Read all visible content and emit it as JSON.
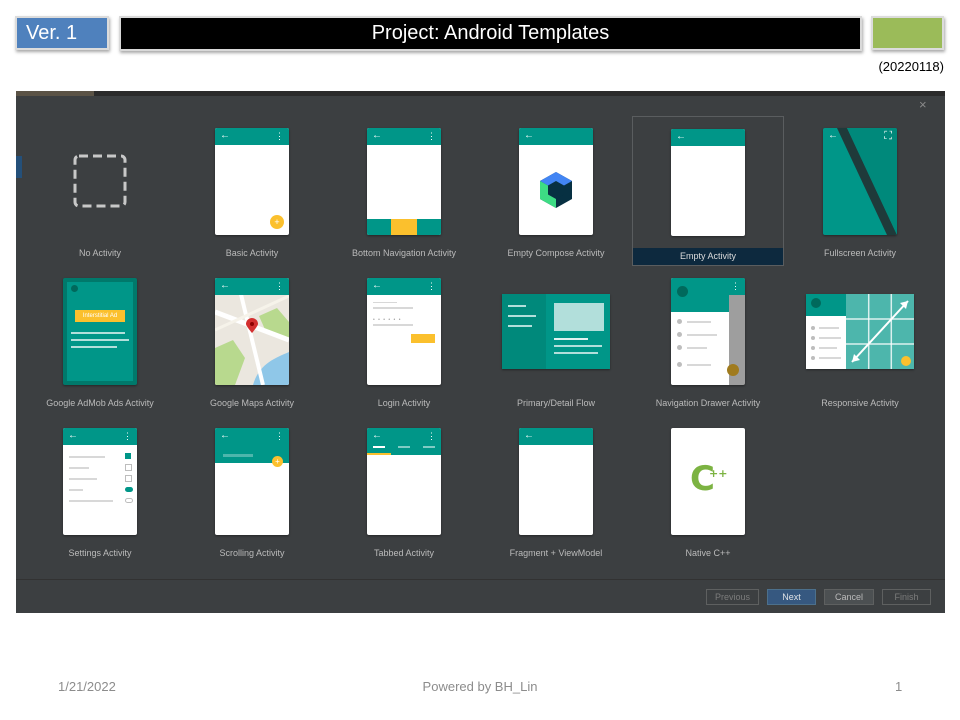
{
  "slide": {
    "version_label": "Ver. 1",
    "title": "Project: Android Templates",
    "date_code": "(20220118)",
    "footer": {
      "date": "1/21/2022",
      "center": "Powered by BH_Lin",
      "page": "1"
    }
  },
  "dialog": {
    "close_glyph": "×",
    "templates": [
      {
        "label": "No Activity",
        "preview": "none",
        "selected": false
      },
      {
        "label": "Basic Activity",
        "preview": "basic",
        "selected": false
      },
      {
        "label": "Bottom Navigation Activity",
        "preview": "bottom-nav",
        "selected": false
      },
      {
        "label": "Empty Compose Activity",
        "preview": "compose",
        "selected": false
      },
      {
        "label": "Empty Activity",
        "preview": "empty",
        "selected": true
      },
      {
        "label": "Fullscreen Activity",
        "preview": "fullscreen",
        "selected": false
      },
      {
        "label": "Google AdMob Ads Activity",
        "preview": "admob",
        "selected": false
      },
      {
        "label": "Google Maps Activity",
        "preview": "maps",
        "selected": false
      },
      {
        "label": "Login Activity",
        "preview": "login",
        "selected": false
      },
      {
        "label": "Primary/Detail Flow",
        "preview": "primary-detail",
        "selected": false
      },
      {
        "label": "Navigation Drawer Activity",
        "preview": "nav-drawer",
        "selected": false
      },
      {
        "label": "Responsive Activity",
        "preview": "responsive",
        "selected": false
      },
      {
        "label": "Settings Activity",
        "preview": "settings",
        "selected": false
      },
      {
        "label": "Scrolling Activity",
        "preview": "scrolling",
        "selected": false
      },
      {
        "label": "Tabbed Activity",
        "preview": "tabbed",
        "selected": false
      },
      {
        "label": "Fragment + ViewModel",
        "preview": "fragment",
        "selected": false
      },
      {
        "label": "Native C++",
        "preview": "native-cpp",
        "selected": false
      }
    ],
    "admob_badge": "Interstitial Ad",
    "cpp_logo": {
      "letter": "C",
      "plus": "++"
    },
    "buttons": {
      "previous": "Previous",
      "next": "Next",
      "cancel": "Cancel",
      "finish": "Finish"
    }
  },
  "colors": {
    "teal": "#009688",
    "accent": "#fbc02d",
    "dialog_bg": "#3c3f41",
    "version_box": "#4f81bd",
    "green_box": "#9bbb59"
  }
}
